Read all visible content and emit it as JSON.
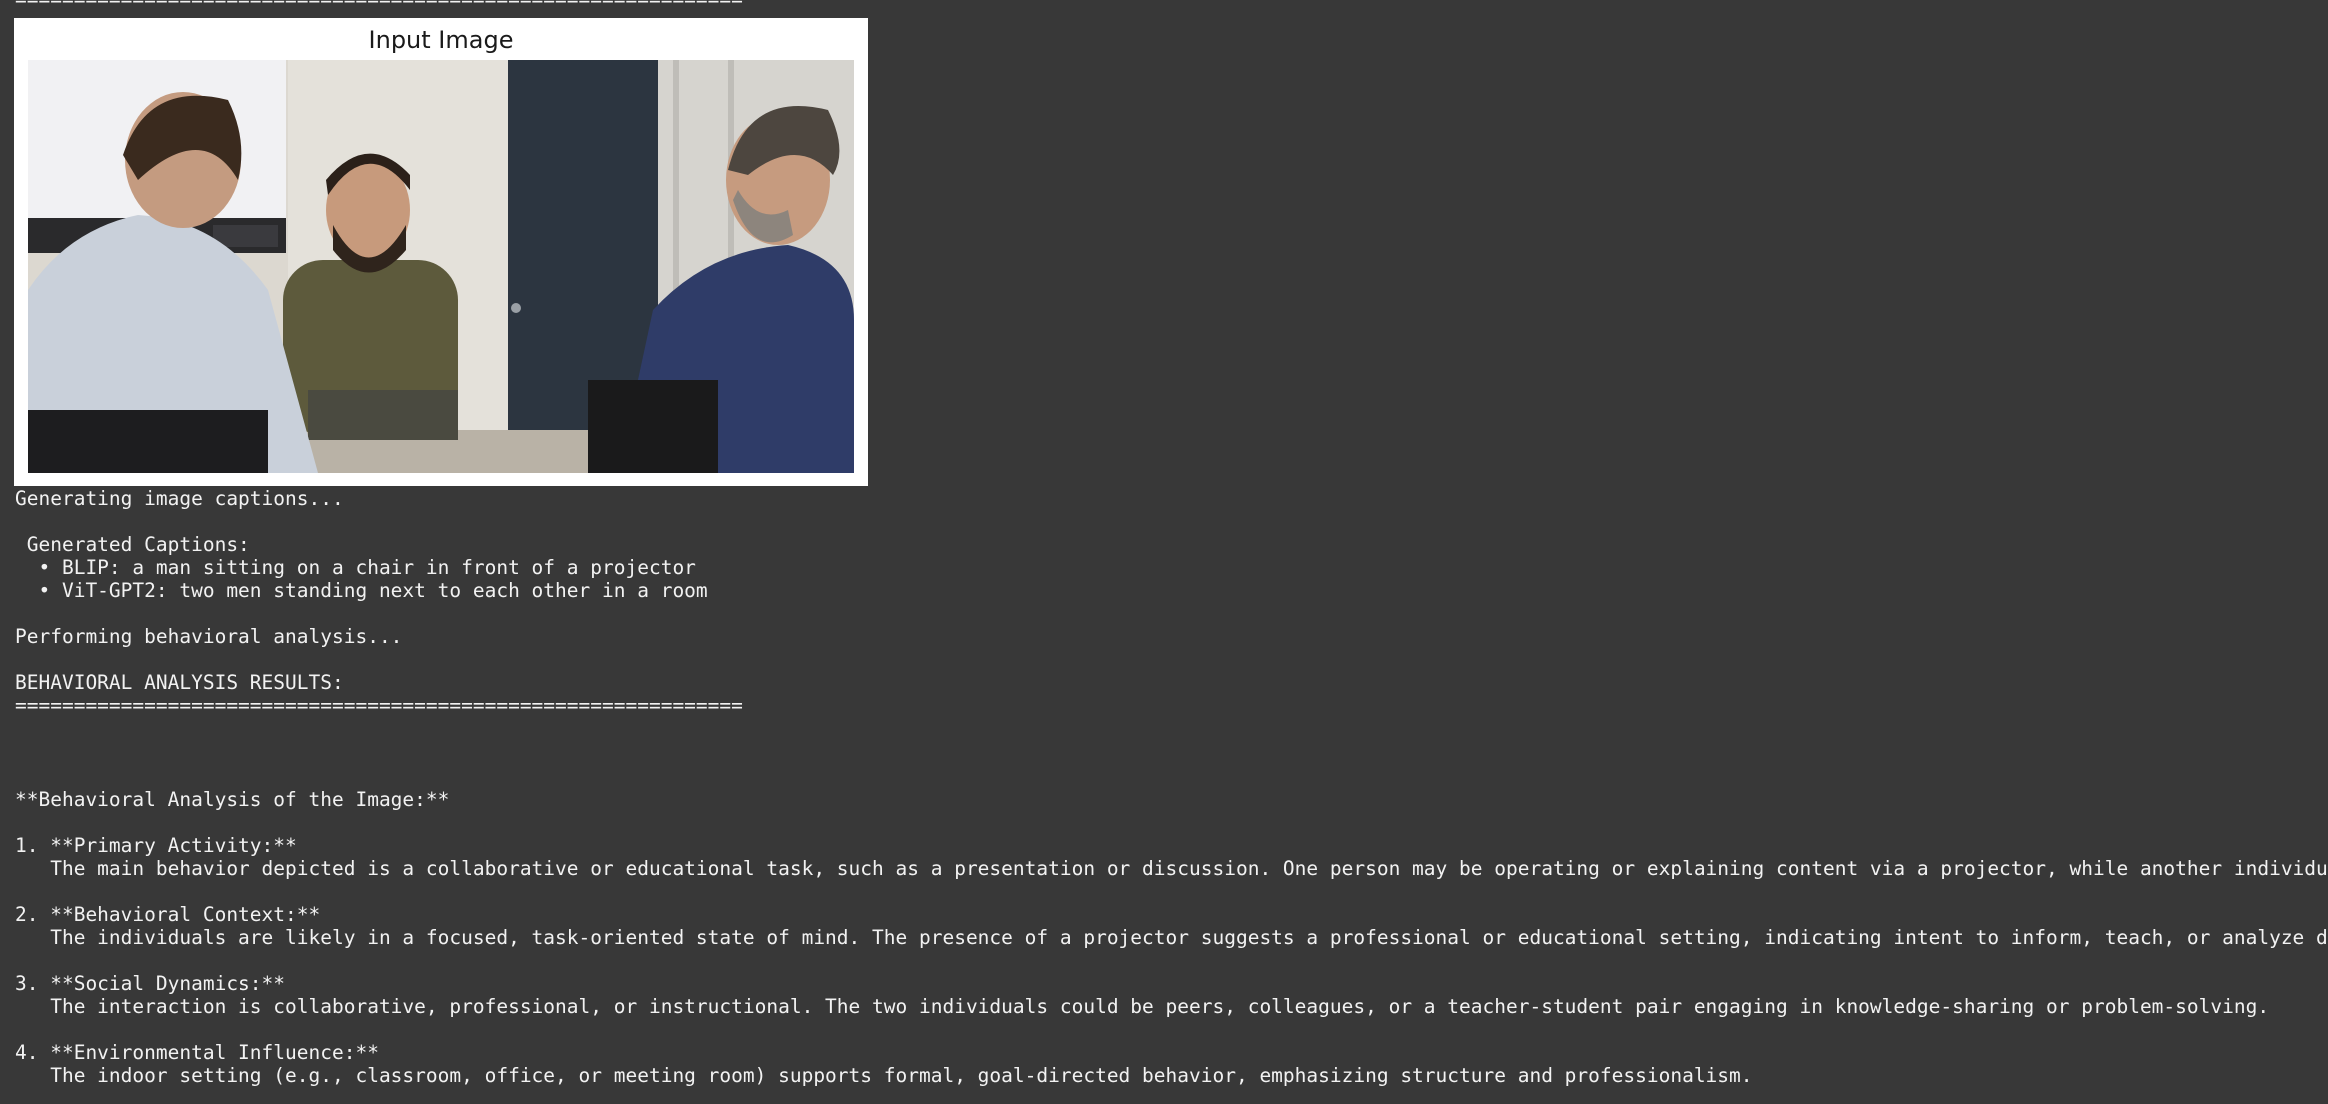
{
  "separator": "==============================================================",
  "figure": {
    "title": "Input Image",
    "photo_description_icon": "photo-of-three-men-in-a-meeting-room"
  },
  "log": {
    "generating": "Generating image captions...",
    "captions_header": " Generated Captions:",
    "caption_blip": "  • BLIP: a man sitting on a chair in front of a projector",
    "caption_vit": "  • ViT-GPT2: two men standing next to each other in a room",
    "performing": "Performing behavioral analysis...",
    "results_header": "BEHAVIORAL ANALYSIS RESULTS:"
  },
  "analysis": {
    "heading": "**Behavioral Analysis of the Image:**",
    "items": [
      {
        "title": "1. **Primary Activity:**",
        "body": "   The main behavior depicted is a collaborative or educational task, such as a presentation or discussion. One person may be operating or explaining content via a projector, while another individual contri"
      },
      {
        "title": "2. **Behavioral Context:**",
        "body": "   The individuals are likely in a focused, task-oriented state of mind. The presence of a projector suggests a professional or educational setting, indicating intent to inform, teach, or analyze data."
      },
      {
        "title": "3. **Social Dynamics:**",
        "body": "   The interaction is collaborative, professional, or instructional. The two individuals could be peers, colleagues, or a teacher-student pair engaging in knowledge-sharing or problem-solving."
      },
      {
        "title": "4. **Environmental Influence:**",
        "body": "   The indoor setting (e.g., classroom, office, or meeting room) supports formal, goal-directed behavior, emphasizing structure and professionalism."
      }
    ]
  }
}
